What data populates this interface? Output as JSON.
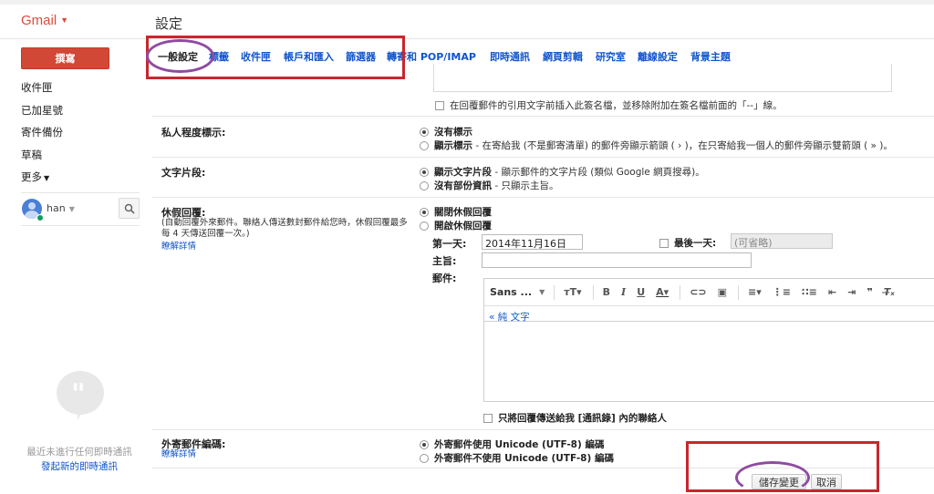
{
  "app": {
    "logo": "Gmail",
    "page_title": "設定"
  },
  "sidebar": {
    "compose_label": "撰寫",
    "items": [
      {
        "label": "收件匣"
      },
      {
        "label": "已加星號"
      },
      {
        "label": "寄件備份"
      },
      {
        "label": "草稿"
      },
      {
        "label": "更多"
      }
    ],
    "user_name": "han",
    "hangouts_empty_text": "最近未進行任何即時通訊",
    "hangouts_start_link": "發起新的即時通訊"
  },
  "tabs": [
    {
      "label": "一般設定",
      "active": true
    },
    {
      "label": "標籤"
    },
    {
      "label": "收件匣"
    },
    {
      "label": "帳戶和匯入"
    },
    {
      "label": "篩選器"
    },
    {
      "label": "轉寄和 POP/IMAP"
    },
    {
      "label": "即時通訊"
    },
    {
      "label": "網頁剪輯"
    },
    {
      "label": "研究室"
    },
    {
      "label": "離線設定"
    },
    {
      "label": "背景主題"
    }
  ],
  "signature": {
    "insert_before_quote": "在回覆郵件的引用文字前插入此簽名檔，並移除附加在簽名檔前面的「--」線。"
  },
  "privacy": {
    "label": "私人程度標示:",
    "opt_none": "沒有標示",
    "opt_show_bold": "顯示標示",
    "opt_show_rest": " - 在寄給我 (不是郵寄清單) 的郵件旁顯示箭頭 ( › )，在只寄給我一個人的郵件旁顯示雙箭頭 ( » )。"
  },
  "snippets": {
    "label": "文字片段:",
    "opt_show_bold": "顯示文字片段",
    "opt_show_rest": " - 顯示郵件的文字片段 (類似 Google 網頁搜尋)。",
    "opt_hide_bold": "沒有部份資訊",
    "opt_hide_rest": " - 只顯示主旨。"
  },
  "vacation": {
    "label": "休假回覆:",
    "desc": "(自動回覆外來郵件。聯絡人傳送數封郵件給您時，休假回覆最多每 4 天傳送回覆一次。)",
    "learn_more": "瞭解詳情",
    "opt_off": "關閉休假回覆",
    "opt_on": "開啟休假回覆",
    "first_day_label": "第一天:",
    "first_day_value": "2014年11月16日",
    "last_day_label": "最後一天:",
    "last_day_placeholder": "(可省略)",
    "subject_label": "主旨:",
    "message_label": "郵件:",
    "font_name": "Sans ...",
    "plain_text_link": "« 純 文字",
    "contacts_only": "只將回覆傳送給我 [通訊錄] 內的聯絡人"
  },
  "encoding": {
    "label": "外寄郵件編碼:",
    "learn_more": "瞭解詳情",
    "opt_utf8": "外寄郵件使用 Unicode (UTF-8) 編碼",
    "opt_no_utf8": "外寄郵件不使用 Unicode (UTF-8) 編碼"
  },
  "actions": {
    "save": "儲存變更",
    "cancel": "取消"
  },
  "colors": {
    "accent_red": "#dd4b39",
    "link_blue": "#1155cc",
    "annotation_red": "#c9262e",
    "annotation_purple": "#8e4ba1"
  }
}
